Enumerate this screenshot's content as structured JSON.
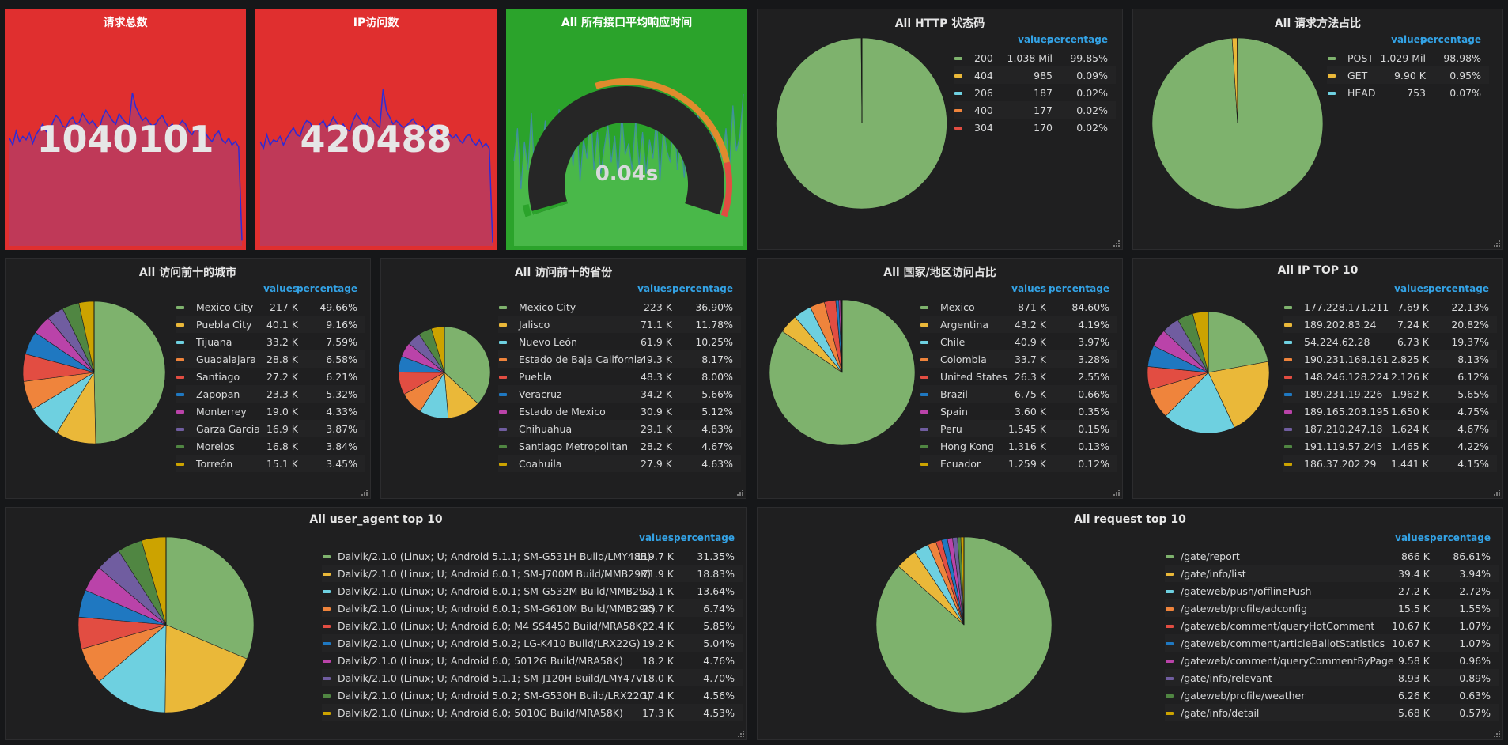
{
  "stats": [
    {
      "title": "请求总数",
      "value": "1040101",
      "bg": "#e02f2f",
      "spark": [
        62,
        58,
        66,
        60,
        63,
        61,
        65,
        59,
        64,
        67,
        70,
        66,
        64,
        71,
        75,
        73,
        69,
        68,
        72,
        74,
        70,
        71,
        76,
        73,
        70,
        72,
        69,
        67,
        74,
        78,
        75,
        72,
        70,
        76,
        73,
        71,
        69,
        88,
        80,
        76,
        72,
        74,
        71,
        69,
        70,
        73,
        75,
        71,
        68,
        70,
        67,
        69,
        72,
        70,
        66,
        64,
        68,
        66,
        63,
        65,
        62,
        60,
        64,
        66,
        61,
        59,
        62,
        58,
        60,
        57,
        3
      ]
    },
    {
      "title": "IP访问数",
      "value": "420488",
      "bg": "#e02f2f",
      "spark": [
        60,
        56,
        64,
        58,
        61,
        60,
        63,
        58,
        62,
        65,
        68,
        64,
        63,
        69,
        72,
        71,
        67,
        66,
        70,
        72,
        68,
        70,
        74,
        71,
        68,
        70,
        67,
        66,
        72,
        76,
        73,
        70,
        69,
        74,
        72,
        70,
        68,
        90,
        78,
        74,
        70,
        72,
        70,
        68,
        69,
        71,
        73,
        70,
        67,
        69,
        66,
        68,
        70,
        68,
        65,
        63,
        66,
        64,
        62,
        64,
        61,
        59,
        63,
        64,
        60,
        58,
        61,
        57,
        59,
        56,
        2
      ]
    }
  ],
  "gauge": {
    "title": "All 所有接口平均响应时间",
    "value": "0.04s",
    "bg": "#2ba32b",
    "spark": [
      45,
      62,
      30,
      55,
      40,
      70,
      35,
      52,
      48,
      66,
      38,
      58,
      44,
      72,
      36,
      50,
      62,
      42,
      68,
      34,
      56,
      46,
      74,
      40,
      60,
      38,
      52,
      64,
      44,
      58,
      36,
      70,
      48,
      54,
      40,
      66,
      42,
      60,
      38,
      56,
      46,
      68,
      34,
      62,
      50,
      44,
      72,
      40,
      58,
      36,
      64,
      48,
      52,
      70,
      38,
      60,
      44,
      66,
      42,
      54,
      46,
      62,
      40,
      74,
      50,
      58,
      80
    ]
  },
  "pies": [
    {
      "title": "All HTTP 状态码",
      "hv": "values",
      "hp": "percentage",
      "rows": [
        [
          "200",
          "1.038 Mil",
          "99.85%",
          99.85
        ],
        [
          "404",
          "985",
          "0.09%",
          0.09
        ],
        [
          "206",
          "187",
          "0.02%",
          0.02
        ],
        [
          "400",
          "177",
          "0.02%",
          0.02
        ],
        [
          "304",
          "170",
          "0.02%",
          0.02
        ]
      ]
    },
    {
      "title": "All 请求方法占比",
      "hv": "values",
      "hp": "percentage",
      "rows": [
        [
          "POST",
          "1.029 Mil",
          "98.98%",
          98.98
        ],
        [
          "GET",
          "9.90 K",
          "0.95%",
          0.95
        ],
        [
          "HEAD",
          "753",
          "0.07%",
          0.07
        ]
      ]
    },
    {
      "title": "All 访问前十的城市",
      "hv": "values",
      "hp": "percentage",
      "rows": [
        [
          "Mexico City",
          "217 K",
          "49.66%",
          49.66
        ],
        [
          "Puebla City",
          "40.1 K",
          "9.16%",
          9.16
        ],
        [
          "Tijuana",
          "33.2 K",
          "7.59%",
          7.59
        ],
        [
          "Guadalajara",
          "28.8 K",
          "6.58%",
          6.58
        ],
        [
          "Santiago",
          "27.2 K",
          "6.21%",
          6.21
        ],
        [
          "Zapopan",
          "23.3 K",
          "5.32%",
          5.32
        ],
        [
          "Monterrey",
          "19.0 K",
          "4.33%",
          4.33
        ],
        [
          "Garza Garcia",
          "16.9 K",
          "3.87%",
          3.87
        ],
        [
          "Morelos",
          "16.8 K",
          "3.84%",
          3.84
        ],
        [
          "Torreón",
          "15.1 K",
          "3.45%",
          3.45
        ]
      ]
    },
    {
      "title": "All 访问前十的省份",
      "hv": "values",
      "hp": "percentage",
      "rows": [
        [
          "Mexico City",
          "223 K",
          "36.90%",
          36.9
        ],
        [
          "Jalisco",
          "71.1 K",
          "11.78%",
          11.78
        ],
        [
          "Nuevo León",
          "61.9 K",
          "10.25%",
          10.25
        ],
        [
          "Estado de Baja California",
          "49.3 K",
          "8.17%",
          8.17
        ],
        [
          "Puebla",
          "48.3 K",
          "8.00%",
          8.0
        ],
        [
          "Veracruz",
          "34.2 K",
          "5.66%",
          5.66
        ],
        [
          "Estado de Mexico",
          "30.9 K",
          "5.12%",
          5.12
        ],
        [
          "Chihuahua",
          "29.1 K",
          "4.83%",
          4.83
        ],
        [
          "Santiago Metropolitan",
          "28.2 K",
          "4.67%",
          4.67
        ],
        [
          "Coahuila",
          "27.9 K",
          "4.63%",
          4.63
        ]
      ]
    },
    {
      "title": "All 国家/地区访问占比",
      "hv": "values",
      "hp": "percentage",
      "rows": [
        [
          "Mexico",
          "871 K",
          "84.60%",
          84.6
        ],
        [
          "Argentina",
          "43.2 K",
          "4.19%",
          4.19
        ],
        [
          "Chile",
          "40.9 K",
          "3.97%",
          3.97
        ],
        [
          "Colombia",
          "33.7 K",
          "3.28%",
          3.28
        ],
        [
          "United States",
          "26.3 K",
          "2.55%",
          2.55
        ],
        [
          "Brazil",
          "6.75 K",
          "0.66%",
          0.66
        ],
        [
          "Spain",
          "3.60 K",
          "0.35%",
          0.35
        ],
        [
          "Peru",
          "1.545 K",
          "0.15%",
          0.15
        ],
        [
          "Hong Kong",
          "1.316 K",
          "0.13%",
          0.13
        ],
        [
          "Ecuador",
          "1.259 K",
          "0.12%",
          0.12
        ]
      ]
    },
    {
      "title": "All IP TOP 10",
      "hv": "values",
      "hp": "percentage",
      "rows": [
        [
          "177.228.171.211",
          "7.69 K",
          "22.13%",
          22.13
        ],
        [
          "189.202.83.24",
          "7.24 K",
          "20.82%",
          20.82
        ],
        [
          "54.224.62.28",
          "6.73 K",
          "19.37%",
          19.37
        ],
        [
          "190.231.168.161",
          "2.825 K",
          "8.13%",
          8.13
        ],
        [
          "148.246.128.224",
          "2.126 K",
          "6.12%",
          6.12
        ],
        [
          "189.231.19.226",
          "1.962 K",
          "5.65%",
          5.65
        ],
        [
          "189.165.203.195",
          "1.650 K",
          "4.75%",
          4.75
        ],
        [
          "187.210.247.18",
          "1.624 K",
          "4.67%",
          4.67
        ],
        [
          "191.119.57.245",
          "1.465 K",
          "4.22%",
          4.22
        ],
        [
          "186.37.202.29",
          "1.441 K",
          "4.15%",
          4.15
        ]
      ]
    },
    {
      "title": "All user_agent top 10",
      "hv": "values",
      "hp": "percentage",
      "rows": [
        [
          "Dalvik/2.1.0 (Linux; U; Android 5.1.1; SM-G531H Build/LMY48B)",
          "119.7 K",
          "31.35%",
          31.35
        ],
        [
          "Dalvik/2.1.0 (Linux; U; Android 6.0.1; SM-J700M Build/MMB29K)",
          "71.9 K",
          "18.83%",
          18.83
        ],
        [
          "Dalvik/2.1.0 (Linux; U; Android 6.0.1; SM-G532M Build/MMB29T)",
          "52.1 K",
          "13.64%",
          13.64
        ],
        [
          "Dalvik/2.1.0 (Linux; U; Android 6.0.1; SM-G610M Build/MMB29K)",
          "25.7 K",
          "6.74%",
          6.74
        ],
        [
          "Dalvik/2.1.0 (Linux; U; Android 6.0; M4 SS4450 Build/MRA58K)",
          "22.4 K",
          "5.85%",
          5.85
        ],
        [
          "Dalvik/2.1.0 (Linux; U; Android 5.0.2; LG-K410 Build/LRX22G)",
          "19.2 K",
          "5.04%",
          5.04
        ],
        [
          "Dalvik/2.1.0 (Linux; U; Android 6.0; 5012G Build/MRA58K)",
          "18.2 K",
          "4.76%",
          4.76
        ],
        [
          "Dalvik/2.1.0 (Linux; U; Android 5.1.1; SM-J120H Build/LMY47V)",
          "18.0 K",
          "4.70%",
          4.7
        ],
        [
          "Dalvik/2.1.0 (Linux; U; Android 5.0.2; SM-G530H Build/LRX22G)",
          "17.4 K",
          "4.56%",
          4.56
        ],
        [
          "Dalvik/2.1.0 (Linux; U; Android 6.0; 5010G Build/MRA58K)",
          "17.3 K",
          "4.53%",
          4.53
        ]
      ]
    },
    {
      "title": "All request top 10",
      "hv": "values",
      "hp": "percentage",
      "rows": [
        [
          "/gate/report",
          "866 K",
          "86.61%",
          86.61
        ],
        [
          "/gate/info/list",
          "39.4 K",
          "3.94%",
          3.94
        ],
        [
          "/gateweb/push/offlinePush",
          "27.2 K",
          "2.72%",
          2.72
        ],
        [
          "/gateweb/profile/adconfig",
          "15.5 K",
          "1.55%",
          1.55
        ],
        [
          "/gateweb/comment/queryHotComment",
          "10.67 K",
          "1.07%",
          1.07
        ],
        [
          "/gateweb/comment/articleBallotStatistics",
          "10.67 K",
          "1.07%",
          1.07
        ],
        [
          "/gateweb/comment/queryCommentByPage",
          "9.58 K",
          "0.96%",
          0.96
        ],
        [
          "/gate/info/relevant",
          "8.93 K",
          "0.89%",
          0.89
        ],
        [
          "/gateweb/profile/weather",
          "6.26 K",
          "0.63%",
          0.63
        ],
        [
          "/gate/info/detail",
          "5.68 K",
          "0.57%",
          0.57
        ]
      ]
    }
  ],
  "colors": {
    "series": [
      "#7eb26d",
      "#eab839",
      "#6ed0e0",
      "#ef843c",
      "#e24d42",
      "#1f78c1",
      "#ba43a9",
      "#705da0",
      "#508642",
      "#cca300"
    ],
    "legend_header": "#33a2e5",
    "stat_line": "#2d2bd6",
    "gauge_green": "#2ba32b",
    "gauge_orange": "#e08b2d",
    "gauge_red": "#e24d42"
  },
  "chart_data": [
    {
      "type": "pie",
      "title": "All HTTP 状态码",
      "categories": [
        "200",
        "404",
        "206",
        "400",
        "304"
      ],
      "values": [
        99.85,
        0.09,
        0.02,
        0.02,
        0.02
      ]
    },
    {
      "type": "pie",
      "title": "All 请求方法占比",
      "categories": [
        "POST",
        "GET",
        "HEAD"
      ],
      "values": [
        98.98,
        0.95,
        0.07
      ]
    },
    {
      "type": "pie",
      "title": "All 访问前十的城市",
      "categories": [
        "Mexico City",
        "Puebla City",
        "Tijuana",
        "Guadalajara",
        "Santiago",
        "Zapopan",
        "Monterrey",
        "Garza Garcia",
        "Morelos",
        "Torreón"
      ],
      "values": [
        49.66,
        9.16,
        7.59,
        6.58,
        6.21,
        5.32,
        4.33,
        3.87,
        3.84,
        3.45
      ]
    },
    {
      "type": "pie",
      "title": "All 访问前十的省份",
      "categories": [
        "Mexico City",
        "Jalisco",
        "Nuevo León",
        "Estado de Baja California",
        "Puebla",
        "Veracruz",
        "Estado de Mexico",
        "Chihuahua",
        "Santiago Metropolitan",
        "Coahuila"
      ],
      "values": [
        36.9,
        11.78,
        10.25,
        8.17,
        8.0,
        5.66,
        5.12,
        4.83,
        4.67,
        4.63
      ]
    },
    {
      "type": "pie",
      "title": "All 国家/地区访问占比",
      "categories": [
        "Mexico",
        "Argentina",
        "Chile",
        "Colombia",
        "United States",
        "Brazil",
        "Spain",
        "Peru",
        "Hong Kong",
        "Ecuador"
      ],
      "values": [
        84.6,
        4.19,
        3.97,
        3.28,
        2.55,
        0.66,
        0.35,
        0.15,
        0.13,
        0.12
      ]
    },
    {
      "type": "pie",
      "title": "All IP TOP 10",
      "categories": [
        "177.228.171.211",
        "189.202.83.24",
        "54.224.62.28",
        "190.231.168.161",
        "148.246.128.224",
        "189.231.19.226",
        "189.165.203.195",
        "187.210.247.18",
        "191.119.57.245",
        "186.37.202.29"
      ],
      "values": [
        22.13,
        20.82,
        19.37,
        8.13,
        6.12,
        5.65,
        4.75,
        4.67,
        4.22,
        4.15
      ]
    },
    {
      "type": "pie",
      "title": "All user_agent top 10",
      "categories": [
        "SM-G531H",
        "SM-J700M",
        "SM-G532M",
        "SM-G610M",
        "M4 SS4450",
        "LG-K410",
        "5012G",
        "SM-J120H",
        "SM-G530H",
        "5010G"
      ],
      "values": [
        31.35,
        18.83,
        13.64,
        6.74,
        5.85,
        5.04,
        4.76,
        4.7,
        4.56,
        4.53
      ]
    },
    {
      "type": "pie",
      "title": "All request top 10",
      "categories": [
        "/gate/report",
        "/gate/info/list",
        "/gateweb/push/offlinePush",
        "/gateweb/profile/adconfig",
        "/gateweb/comment/queryHotComment",
        "/gateweb/comment/articleBallotStatistics",
        "/gateweb/comment/queryCommentByPage",
        "/gate/info/relevant",
        "/gateweb/profile/weather",
        "/gate/info/detail"
      ],
      "values": [
        86.61,
        3.94,
        2.72,
        1.55,
        1.07,
        1.07,
        0.96,
        0.89,
        0.63,
        0.57
      ]
    }
  ]
}
